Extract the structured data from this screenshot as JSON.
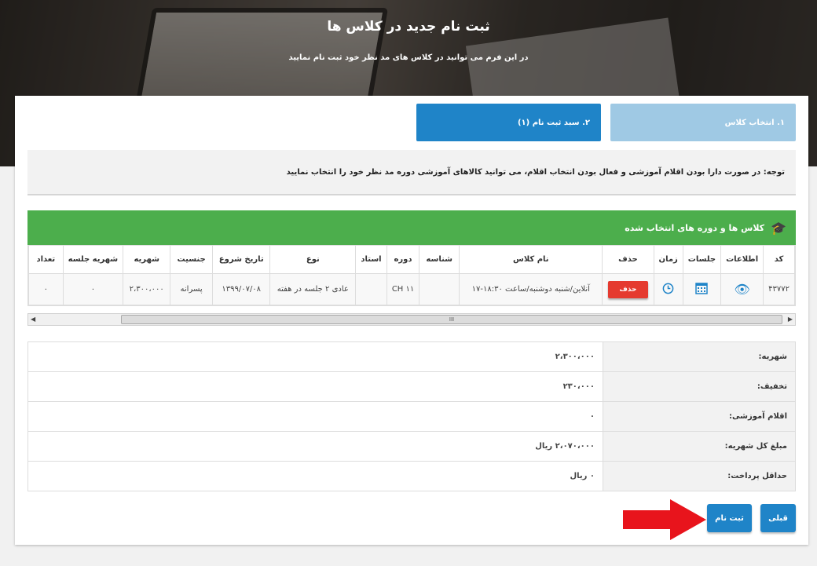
{
  "hero": {
    "title": "ثبت نام جدید در کلاس ها",
    "subtitle": "در این فرم می توانید در کلاس های مد نظر خود ثبت نام نمایید"
  },
  "steps": [
    {
      "label": "۱. انتخاب کلاس"
    },
    {
      "label": "۲. سبد ثبت نام (۱)"
    }
  ],
  "notice": "توجه: در صورت دارا بودن اقلام آموزشی و فعال بودن انتخاب اقلام، می توانید کالاهای آموزشی دوره مد نظر خود را انتخاب نمایید",
  "selected_section": {
    "title": "کلاس ها و دوره های انتخاب شده",
    "icon": "graduation-cap-icon"
  },
  "table": {
    "headers": {
      "code": "کد",
      "info": "اطلاعات",
      "sessions": "جلسات",
      "time": "زمان",
      "delete": "حذف",
      "class_name": "نام کلاس",
      "id": "شناسه",
      "course": "دوره",
      "teacher": "استاد",
      "type": "نوع",
      "start_date": "تاریخ شروع",
      "gender": "جنسیت",
      "tuition": "شهریه",
      "session_fee": "شهریه جلسه",
      "count": "تعداد"
    },
    "row": {
      "code": "۴۳۷۷۲",
      "delete_label": "حذف",
      "class_name": "آنلاین/شنبه دوشنبه/ساعت ۱۸:۳۰-۱۷",
      "id": "",
      "course": "CH ۱۱",
      "teacher": "",
      "type": "عادی ۲ جلسه در هفته",
      "start_date": "۱۳۹۹/۰۷/۰۸",
      "gender": "پسرانه",
      "tuition": "۲،۳۰۰،۰۰۰",
      "session_fee": "۰",
      "count": "۰"
    }
  },
  "scrollbar": {
    "grip": "III"
  },
  "summary": [
    {
      "label": "شهریه:",
      "value": "۲،۳۰۰،۰۰۰",
      "style": "plain"
    },
    {
      "label": "تخفیف:",
      "value": "۲۳۰،۰۰۰",
      "style": "plain"
    },
    {
      "label": "اقلام آموزشی:",
      "value": "۰",
      "style": "plain"
    },
    {
      "label": "مبلغ کل شهریه:",
      "value": "۲،۰۷۰،۰۰۰ ریال",
      "style": "blue"
    },
    {
      "label": "حداقل پرداخت:",
      "value": "۰ ریال",
      "style": "red"
    }
  ],
  "buttons": {
    "prev": "قبلی",
    "submit": "ثبت نام"
  },
  "colors": {
    "primary": "#1f84c8",
    "success": "#4cae4c",
    "danger": "#e53a2f",
    "annotation_arrow": "#e8141c"
  }
}
